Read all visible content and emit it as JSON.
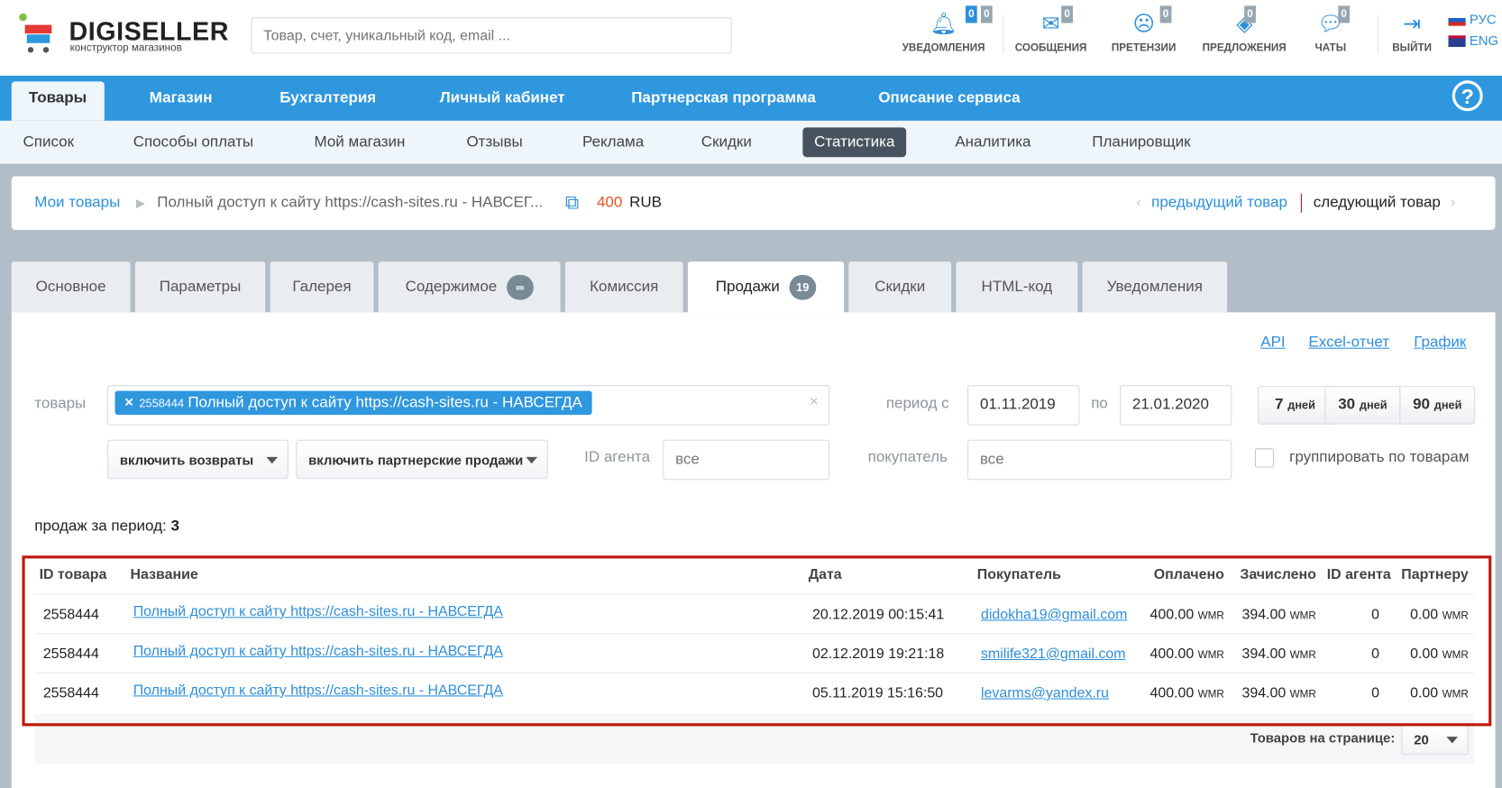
{
  "header": {
    "logo_title": "DIGISELLER",
    "logo_subtitle": "конструктор магазинов",
    "search_placeholder": "Товар, счет, уникальный код, email ...",
    "icons": [
      {
        "name": "bell-icon",
        "label": "УВЕДОМЛЕНИЯ",
        "counts": [
          "0",
          "0"
        ]
      },
      {
        "name": "envelope-icon",
        "label": "СООБЩЕНИЯ",
        "counts": [
          "0"
        ]
      },
      {
        "name": "sad-face-icon",
        "label": "ПРЕТЕНЗИИ",
        "counts": [
          "0"
        ]
      },
      {
        "name": "offer-icon",
        "label": "ПРЕДЛОЖЕНИЯ",
        "counts": [
          "0"
        ]
      },
      {
        "name": "chat-icon",
        "label": "ЧАТЫ",
        "counts": [
          "0"
        ]
      }
    ],
    "logout_label": "ВЫЙТИ",
    "lang_ru": "РУС",
    "lang_en": "ENG"
  },
  "nav": {
    "items": [
      "Товары",
      "Магазин",
      "Бухгалтерия",
      "Личный кабинет",
      "Партнерская программа",
      "Описание сервиса"
    ],
    "help": "?"
  },
  "subnav": {
    "items": [
      "Список",
      "Способы оплаты",
      "Мой магазин",
      "Отзывы",
      "Реклама",
      "Скидки",
      "Статистика",
      "Аналитика",
      "Планировщик"
    ]
  },
  "breadcrumb": {
    "root": "Мои товары",
    "current": "Полный доступ к сайту https://cash-sites.ru - НАВСЕГ...",
    "price": "400",
    "currency": "RUB",
    "prev": "предыдущий товар",
    "next": "следующий товар"
  },
  "tabs": [
    {
      "label": "Основное"
    },
    {
      "label": "Параметры"
    },
    {
      "label": "Галерея"
    },
    {
      "label": "Содержимое",
      "badge": "∞"
    },
    {
      "label": "Комиссия"
    },
    {
      "label": "Продажи",
      "badge": "19"
    },
    {
      "label": "Скидки"
    },
    {
      "label": "HTML-код"
    },
    {
      "label": "Уведомления"
    }
  ],
  "links": {
    "api": "API",
    "excel": "Excel-отчет",
    "chart": "График"
  },
  "filters": {
    "goods_label": "товары",
    "goods_tag_id": "2558444",
    "goods_tag_name": "Полный доступ к сайту https://cash-sites.ru - НАВСЕГДА",
    "period_from_label": "период с",
    "period_from": "01.11.2019",
    "period_to_label": "по",
    "period_to": "21.01.2020",
    "quick": [
      {
        "num": "7",
        "unit": "дней"
      },
      {
        "num": "30",
        "unit": "дней"
      },
      {
        "num": "90",
        "unit": "дней"
      }
    ],
    "returns": "включить возвраты",
    "partner_sales": "включить партнерские продажи",
    "agent_label": "ID агента",
    "agent_placeholder": "все",
    "buyer_label": "покупатель",
    "buyer_placeholder": "все",
    "group_label": "группировать по товарам"
  },
  "summary": {
    "label": "продаж за период:",
    "count": "3"
  },
  "table": {
    "headers": [
      "ID товара",
      "Название",
      "Дата",
      "Покупатель",
      "Оплачено",
      "Зачислено",
      "ID агента",
      "Партнеру"
    ],
    "rows": [
      {
        "id": "2558444",
        "name": "Полный доступ к сайту https://cash-sites.ru - НАВСЕГДА",
        "date": "20.12.2019 00:15:41",
        "buyer": "didokha19@gmail.com",
        "paid": "400.00",
        "credited": "394.00",
        "agent": "0",
        "partner": "0.00",
        "cur": "WMR"
      },
      {
        "id": "2558444",
        "name": "Полный доступ к сайту https://cash-sites.ru - НАВСЕГДА",
        "date": "02.12.2019 19:21:18",
        "buyer": "smilife321@gmail.com",
        "paid": "400.00",
        "credited": "394.00",
        "agent": "0",
        "partner": "0.00",
        "cur": "WMR"
      },
      {
        "id": "2558444",
        "name": "Полный доступ к сайту https://cash-sites.ru - НАВСЕГДА",
        "date": "05.11.2019 15:16:50",
        "buyer": "levarms@yandex.ru",
        "paid": "400.00",
        "credited": "394.00",
        "agent": "0",
        "partner": "0.00",
        "cur": "WMR"
      }
    ],
    "per_page_label": "Товаров на странице:",
    "per_page": "20"
  }
}
